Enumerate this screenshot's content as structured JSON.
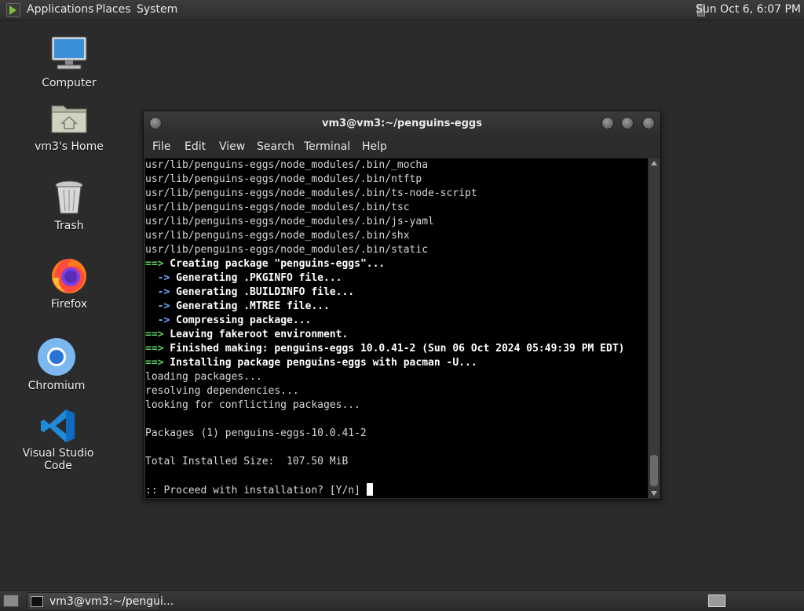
{
  "top_panel": {
    "menus": [
      "Applications",
      "Places",
      "System"
    ],
    "clock": "Sun Oct  6,  6:07 PM"
  },
  "desktop_icons": [
    {
      "label": "Computer",
      "icon": "computer-icon"
    },
    {
      "label": "vm3's Home",
      "icon": "home-folder-icon"
    },
    {
      "label": "Trash",
      "icon": "trash-icon"
    },
    {
      "label": "Firefox",
      "icon": "firefox-icon"
    },
    {
      "label": "Chromium",
      "icon": "chromium-icon"
    },
    {
      "label": "Visual Studio Code",
      "icon": "vscode-icon"
    }
  ],
  "terminal": {
    "title": "vm3@vm3:~/penguins-eggs",
    "menu": [
      "File",
      "Edit",
      "View",
      "Search",
      "Terminal",
      "Help"
    ],
    "lines": [
      "usr/lib/penguins-eggs/node_modules/.bin/_mocha",
      "usr/lib/penguins-eggs/node_modules/.bin/ntftp",
      "usr/lib/penguins-eggs/node_modules/.bin/ts-node-script",
      "usr/lib/penguins-eggs/node_modules/.bin/tsc",
      "usr/lib/penguins-eggs/node_modules/.bin/js-yaml",
      "usr/lib/penguins-eggs/node_modules/.bin/shx",
      "usr/lib/penguins-eggs/node_modules/.bin/static",
      "==> Creating package \"penguins-eggs\"...",
      "  -> Generating .PKGINFO file...",
      "  -> Generating .BUILDINFO file...",
      "  -> Generating .MTREE file...",
      "  -> Compressing package...",
      "==> Leaving fakeroot environment.",
      "==> Finished making: penguins-eggs 10.0.41-2 (Sun 06 Oct 2024 05:49:39 PM EDT)",
      "==> Installing package penguins-eggs with pacman -U...",
      "loading packages...",
      "resolving dependencies...",
      "looking for conflicting packages...",
      "",
      "Packages (1) penguins-eggs-10.0.41-2",
      "",
      "Total Installed Size:  107.50 MiB",
      "",
      ":: Proceed with installation? [Y/n] "
    ]
  },
  "taskbar": {
    "task_label": "vm3@vm3:~/pengui..."
  },
  "colors": {
    "prompt_green": "#5fd35f",
    "arrow_blue": "#6fa8ff",
    "terminal_bg": "#000000",
    "desktop_bg": "#2b2b2b"
  }
}
